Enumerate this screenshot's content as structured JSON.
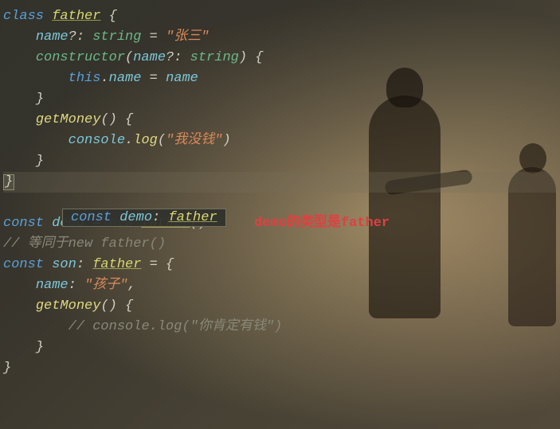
{
  "code": {
    "l1_class": "class",
    "l1_name": "father",
    "l1_brace": " {",
    "l2_indent": "    ",
    "l2_name": "name",
    "l2_opt": "?:",
    "l2_type": " string",
    "l2_eq": " = ",
    "l2_str": "\"张三\"",
    "l3_indent": "    ",
    "l3_ctor": "constructor",
    "l3_paren": "(",
    "l3_param": "name",
    "l3_popt": "?:",
    "l3_ptype": " string",
    "l3_close": ") {",
    "l4_indent": "        ",
    "l4_this": "this",
    "l4_dot": ".",
    "l4_name": "name",
    "l4_eq": " = ",
    "l4_var": "name",
    "l5_indent": "    ",
    "l5_brace": "}",
    "l6_indent": "    ",
    "l6_fn": "getMoney",
    "l6_paren": "() {",
    "l7_indent": "        ",
    "l7_console": "console",
    "l7_dot": ".",
    "l7_log": "log",
    "l7_open": "(",
    "l7_str": "\"我没钱\"",
    "l7_close": ")",
    "l8_indent": "    ",
    "l8_brace": "}",
    "l9_brace": "}",
    "tooltip_const": "const",
    "tooltip_demo": " demo",
    "tooltip_colon": ": ",
    "tooltip_type": "father",
    "l11_const": "const",
    "l11_demo": " demo",
    "l11_eq": " = ",
    "l11_new": "new",
    "l11_sp": " ",
    "l11_cls": "father",
    "l11_paren": "()",
    "annotation": "demo的类型是father",
    "l12_comment": "// 等同于new father()",
    "l13_const": "const",
    "l13_son": " son",
    "l13_colon": ": ",
    "l13_type": "father",
    "l13_eq": " = {",
    "l14_indent": "    ",
    "l14_name": "name",
    "l14_colon": ": ",
    "l14_str": "\"孩子\"",
    "l14_comma": ",",
    "l15_indent": "    ",
    "l15_fn": "getMoney",
    "l15_paren": "() {",
    "l16_indent": "        ",
    "l16_comment": "// console.log(\"你肯定有钱\")",
    "l17_indent": "    ",
    "l17_brace": "}",
    "l18_brace": "}"
  }
}
